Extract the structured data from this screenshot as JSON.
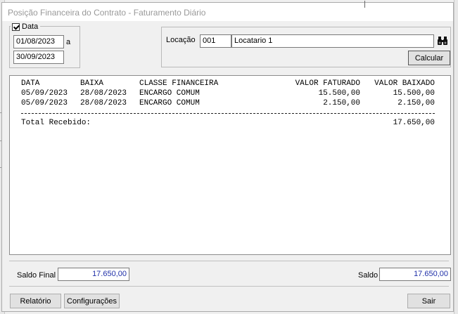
{
  "window": {
    "title": "Posição Financeira do Contrato - Faturamento Diário"
  },
  "date_filter": {
    "checkbox_label": "Data",
    "checked": true,
    "start": "01/08/2023",
    "separator": "a",
    "end": "30/09/2023"
  },
  "location": {
    "label": "Locação",
    "code": "001",
    "name": "Locatario 1",
    "search_icon": "binoculars-icon",
    "calculate_label": "Calcular"
  },
  "report": {
    "headers": {
      "data": "DATA",
      "baixa": "BAIXA",
      "classe": "CLASSE FINANCEIRA",
      "valor_faturado": "VALOR FATURADO",
      "valor_baixado": "VALOR BAIXADO"
    },
    "rows": [
      {
        "data": "05/09/2023",
        "baixa": "28/08/2023",
        "classe": "ENCARGO COMUM",
        "valor_faturado": "15.500,00",
        "valor_baixado": "15.500,00"
      },
      {
        "data": "05/09/2023",
        "baixa": "28/08/2023",
        "classe": "ENCARGO COMUM",
        "valor_faturado": "2.150,00",
        "valor_baixado": "2.150,00"
      }
    ],
    "total_label": "Total Recebido:",
    "total_value": "17.650,00"
  },
  "summary": {
    "saldo_final_label": "Saldo Final",
    "saldo_final_value": "17.650,00",
    "saldo_label": "Saldo",
    "saldo_value": "17.650,00",
    "value_color": "#1f2fa8"
  },
  "footer": {
    "relatorio_label": "Relatório",
    "configuracoes_label": "Configurações",
    "sair_label": "Sair"
  }
}
